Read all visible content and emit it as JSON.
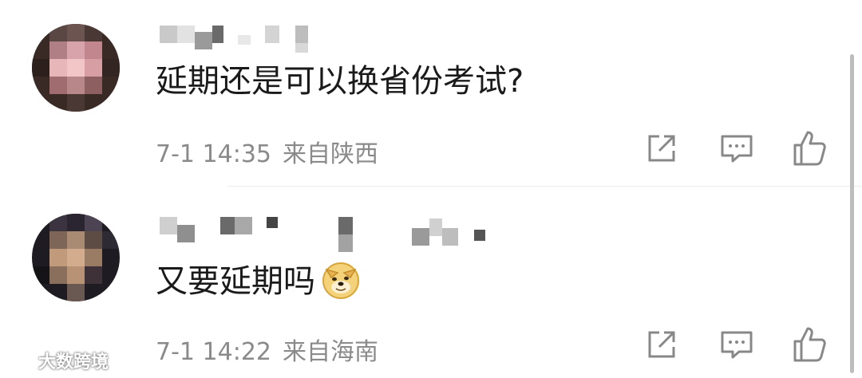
{
  "comments": [
    {
      "text": "延期还是可以换省份考试?",
      "time": "7-1 14:35",
      "location": "来自陕西",
      "emoji": ""
    },
    {
      "text": "又要延期吗",
      "time": "7-1 14:22",
      "location": "来自海南",
      "emoji": "doge-emoji"
    }
  ],
  "actions": {
    "share_icon": "share-icon",
    "comment_icon": "comment-icon",
    "like_icon": "thumbs-up-icon"
  },
  "watermark": "大数跨境",
  "colors": {
    "text": "#1a1a1a",
    "meta": "#8a8a8a",
    "icon": "#888888"
  }
}
